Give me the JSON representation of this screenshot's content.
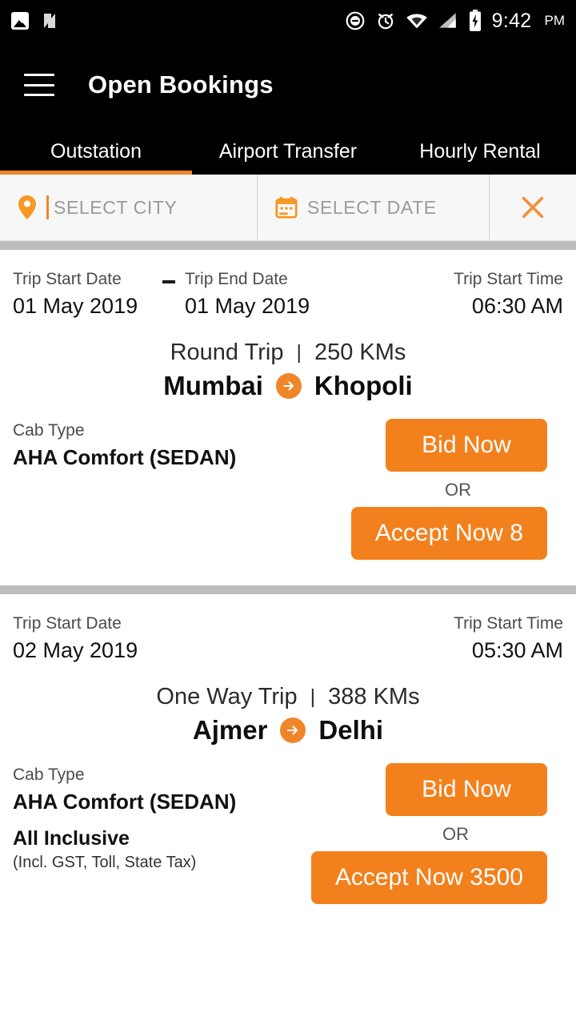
{
  "statusbar": {
    "time": "9:42",
    "ampm": "PM",
    "icons": [
      "photo-icon",
      "android-n-icon",
      "do-not-disturb-icon",
      "alarm-icon",
      "wifi-icon",
      "cell-signal-icon",
      "battery-charging-icon"
    ]
  },
  "appbar": {
    "menu_icon": "hamburger-menu-icon",
    "title": "Open Bookings"
  },
  "tabs": {
    "items": [
      {
        "label": "Outstation",
        "active": true
      },
      {
        "label": "Airport Transfer",
        "active": false
      },
      {
        "label": "Hourly Rental",
        "active": false
      }
    ],
    "indicator_color": "#F0862A"
  },
  "filters": {
    "city": {
      "icon": "location-pin-icon",
      "placeholder": "SELECT CITY",
      "value": ""
    },
    "date": {
      "icon": "calendar-icon",
      "placeholder": "SELECT DATE",
      "value": ""
    },
    "close": {
      "icon": "close-icon",
      "label": ""
    }
  },
  "labels": {
    "trip_start_date": "Trip Start Date",
    "trip_end_date": "Trip End Date",
    "trip_start_time": "Trip Start Time",
    "cab_type": "Cab Type",
    "or": "OR",
    "bid_now": "Bid Now",
    "date_separator": "-"
  },
  "bookings": [
    {
      "start_date": "01 May 2019",
      "end_date": "01 May 2019",
      "start_time": "06:30 AM",
      "trip_type": "Round Trip",
      "divider": "|",
      "distance": "250 KMs",
      "from_city": "Mumbai",
      "to_city": "Khopoli",
      "arrow_icon": "arrow-right-icon",
      "cab_type": "AHA Comfort",
      "cab_category": "(SEDAN)",
      "inclusive": "",
      "inclusive_note": "",
      "bid_label": "Bid Now",
      "accept_label": "Accept Now 8"
    },
    {
      "start_date": "02 May 2019",
      "end_date": "",
      "start_time": "05:30 AM",
      "trip_type": "One Way Trip",
      "divider": "|",
      "distance": "388 KMs",
      "from_city": "Ajmer",
      "to_city": "Delhi",
      "arrow_icon": "arrow-right-icon",
      "cab_type": "AHA Comfort",
      "cab_category": "(SEDAN)",
      "inclusive": "All Inclusive",
      "inclusive_note": "(Incl. GST, Toll, State Tax)",
      "bid_label": "Bid Now",
      "accept_label": "Accept Now 3500"
    }
  ],
  "colors": {
    "accent": "#F0862A",
    "button": "#F2811D",
    "appbar": "#000000",
    "separator": "#BDBDBD",
    "filter_bg": "#F7F7F7"
  }
}
